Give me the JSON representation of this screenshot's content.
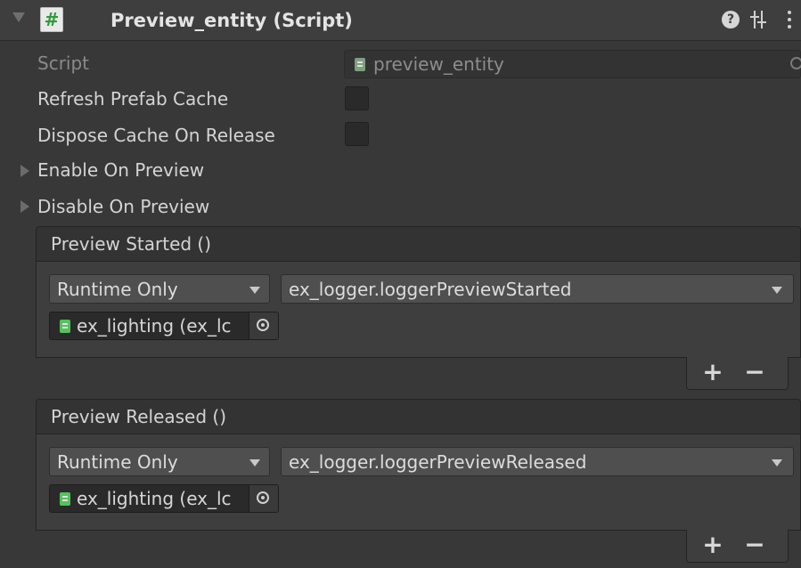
{
  "component": {
    "title": "Preview_entity (Script)",
    "help_icon": "?",
    "icons": [
      "fold-arrow-icon",
      "csharp-script-icon",
      "help-icon",
      "presets-icon",
      "kebab-menu-icon"
    ]
  },
  "fields": {
    "script_label": "Script",
    "script_value": "preview_entity",
    "refresh_label": "Refresh Prefab Cache",
    "refresh_checked": false,
    "dispose_label": "Dispose Cache On Release",
    "dispose_checked": false,
    "enable_label": "Enable On Preview",
    "disable_label": "Disable On Preview"
  },
  "events": [
    {
      "header": "Preview Started ()",
      "runtime": "Runtime Only",
      "function": "ex_logger.loggerPreviewStarted",
      "object": "ex_lighting (ex_lc",
      "add": "+",
      "remove": "−"
    },
    {
      "header": "Preview Released ()",
      "runtime": "Runtime Only",
      "function": "ex_logger.loggerPreviewReleased",
      "object": "ex_lighting (ex_lc",
      "add": "+",
      "remove": "−"
    }
  ]
}
